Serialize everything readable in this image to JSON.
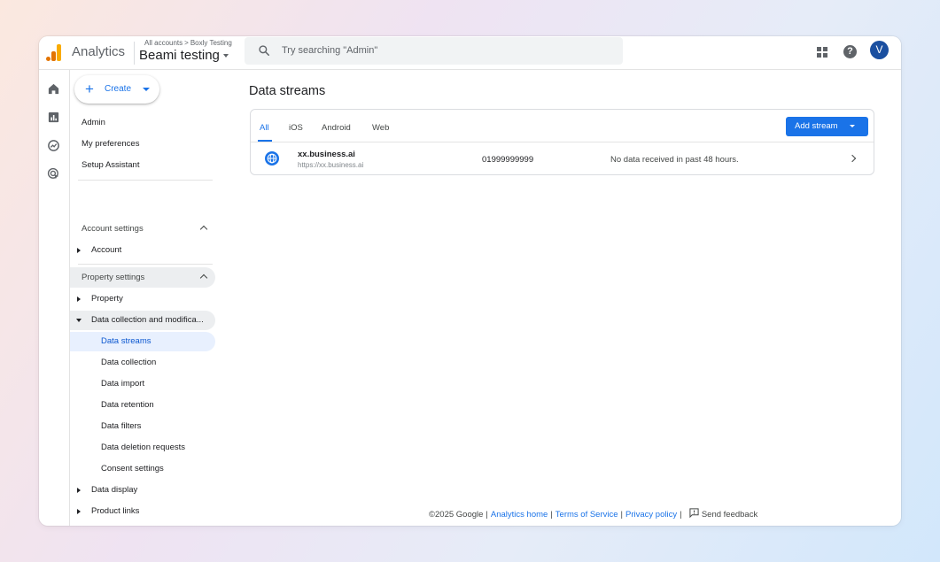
{
  "header": {
    "app_name": "Analytics",
    "breadcrumb_root": "All accounts",
    "breadcrumb_sep": ">",
    "breadcrumb_account": "Boxly Testing",
    "property_name": "Beami testing",
    "search_placeholder": "Try searching \"Admin\"",
    "avatar_letter": "V"
  },
  "nav": {
    "create_label": "Create",
    "top_items": [
      "Admin",
      "My preferences",
      "Setup Assistant"
    ],
    "account_settings": {
      "header": "Account settings",
      "items": [
        "Account"
      ]
    },
    "property_settings": {
      "header": "Property settings",
      "property": "Property",
      "data_collection": "Data collection and modifica...",
      "sub_items": [
        "Data streams",
        "Data collection",
        "Data import",
        "Data retention",
        "Data filters",
        "Data deletion requests",
        "Consent settings"
      ],
      "data_display": "Data display",
      "product_links": "Product links"
    }
  },
  "main": {
    "title": "Data streams",
    "tabs": [
      "All",
      "iOS",
      "Android",
      "Web"
    ],
    "active_tab": "All",
    "add_stream_label": "Add stream",
    "streams": [
      {
        "name": "xx.business.ai",
        "url": "https://xx.business.ai",
        "id": "01999999999",
        "status": "No data received in past 48 hours."
      }
    ]
  },
  "footer": {
    "copyright": "©2025 Google",
    "analytics_home": "Analytics home",
    "terms": "Terms of Service",
    "privacy": "Privacy policy",
    "feedback": "Send feedback"
  },
  "colors": {
    "accent": "#1a73e8",
    "active_bg": "#e8f0fe",
    "logo_orange": "#f9ab00",
    "logo_dark_orange": "#e37400"
  },
  "icons": {
    "rail": [
      "home-icon",
      "reports-icon",
      "explore-icon",
      "advertising-icon",
      "settings-icon"
    ],
    "stream": "globe-icon"
  }
}
